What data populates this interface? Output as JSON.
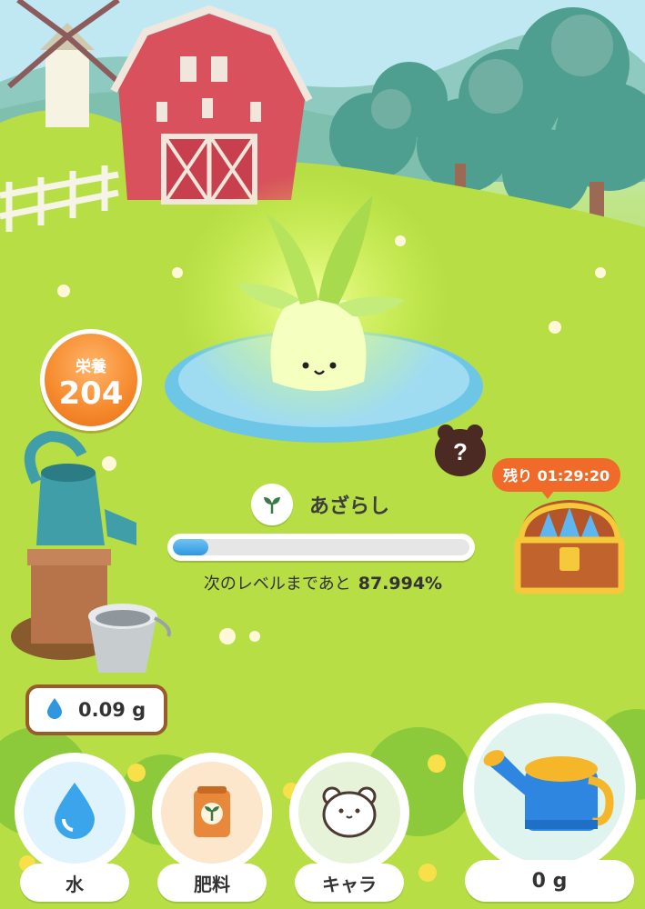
{
  "nutrition": {
    "label": "栄養",
    "value": "204"
  },
  "character": {
    "name": "あざらし",
    "icon": "sprout-icon"
  },
  "level": {
    "prefix": "次のレベルまであと",
    "percent_text": "87.994%",
    "progress_fraction": 0.12
  },
  "treasure": {
    "timer": "残り 01:29:20"
  },
  "mystery_character": {
    "symbol": "?"
  },
  "water_stock": {
    "amount": "0.09 g"
  },
  "menu": [
    {
      "label": "水",
      "icon": "water-drop-icon"
    },
    {
      "label": "肥料",
      "icon": "fertilizer-bag-icon"
    },
    {
      "label": "キャラ",
      "icon": "hamster-icon"
    }
  ],
  "watering_can": {
    "label": "0 g",
    "icon": "watering-can-icon"
  },
  "colors": {
    "accent_orange": "#f6892c",
    "progress_blue": "#2f97e0",
    "timer_orange": "#f06a2a"
  }
}
